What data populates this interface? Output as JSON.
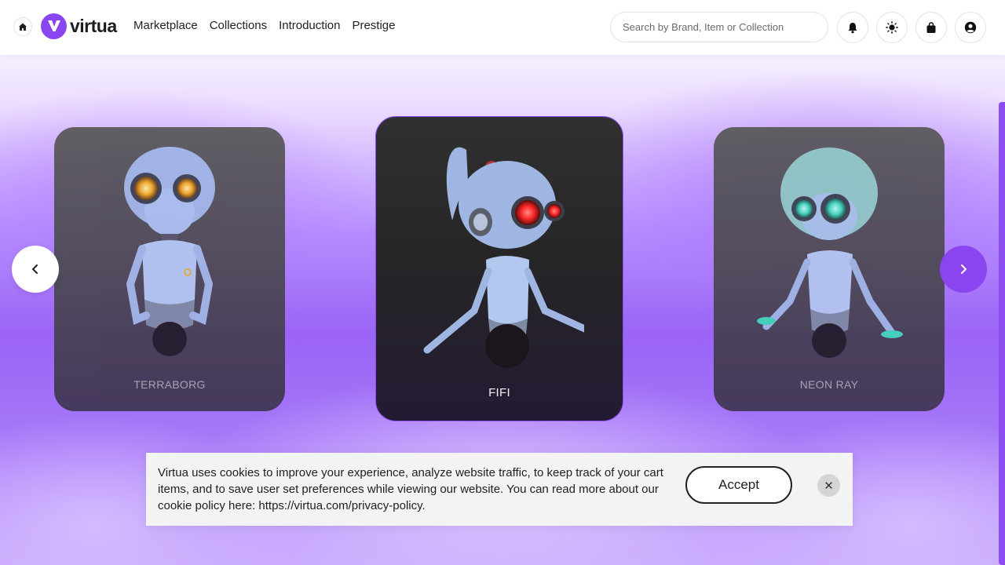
{
  "colors": {
    "brand": "#8b45f0",
    "accent_border": "#8a4df0",
    "banner_bg": "#f3f3f3"
  },
  "header": {
    "logo_text": "virtua",
    "nav": [
      {
        "label": "Marketplace"
      },
      {
        "label": "Collections"
      },
      {
        "label": "Introduction"
      },
      {
        "label": "Prestige"
      }
    ],
    "search": {
      "placeholder": "Search by Brand, Item or Collection",
      "value": ""
    },
    "icons": [
      "home-icon",
      "bell-icon",
      "sun-icon",
      "shopping-bag-icon",
      "user-icon"
    ]
  },
  "carousel": {
    "cards": [
      {
        "name": "TERRABORG",
        "eye_color": "#f3a51d"
      },
      {
        "name": "FIFI",
        "eye_color": "#ff2a2a"
      },
      {
        "name": "NEON RAY",
        "eye_color": "#3fd7b8"
      }
    ],
    "prev_icon": "chevron-left-icon",
    "next_icon": "chevron-right-icon"
  },
  "cookie_banner": {
    "text": "Virtua uses cookies to improve your experience, analyze website traffic, to keep track of your cart items, and to save user set preferences while viewing our website. You can read more about our cookie policy here: https://virtua.com/privacy-policy.",
    "accept_label": "Accept",
    "close_label": "✕"
  }
}
